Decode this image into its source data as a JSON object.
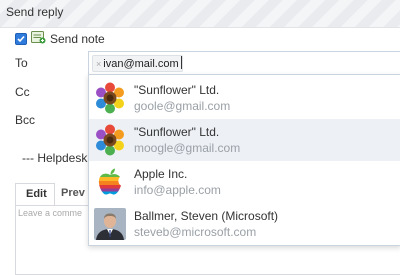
{
  "header": {
    "title": "Send reply"
  },
  "send_note": {
    "label": "Send note",
    "checked": true
  },
  "fields": {
    "to_label": "To",
    "cc_label": "Cc",
    "bcc_label": "Bcc",
    "to_chip": "ivan@mail.com",
    "to_chip_remove": "×"
  },
  "helpdesk_text": "--- Helpdesk",
  "editor": {
    "tab_edit": "Edit",
    "tab_preview": "Prev",
    "placeholder": "Leave a comme"
  },
  "autocomplete": {
    "items": [
      {
        "name": "\"Sunflower\" Ltd.",
        "email": "goole@gmail.com",
        "avatar": "sunflower",
        "highlighted": false
      },
      {
        "name": "\"Sunflower\" Ltd.",
        "email": "moogle@gmail.com",
        "avatar": "sunflower",
        "highlighted": true
      },
      {
        "name": "Apple Inc.",
        "email": "info@apple.com",
        "avatar": "apple",
        "highlighted": false
      },
      {
        "name": "Ballmer, Steven (Microsoft)",
        "email": "steveb@microsoft.com",
        "avatar": "person-photo",
        "highlighted": false
      }
    ]
  },
  "colors": {
    "accent": "#2f7bdc",
    "highlight": "#edf1f6",
    "muted": "#9aa0a6"
  }
}
